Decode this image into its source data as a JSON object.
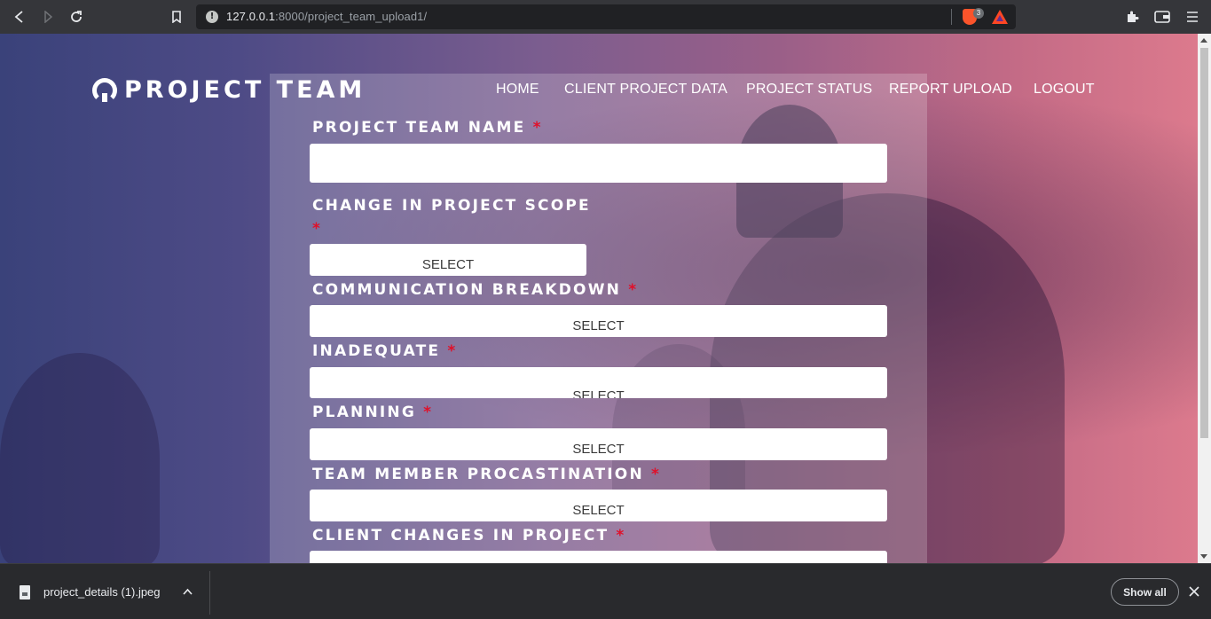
{
  "browser": {
    "url_host": "127.0.0.1",
    "url_rest": ":8000/project_team_upload1/",
    "shield_count": "3",
    "icons": {
      "back": "back-arrow-icon",
      "forward": "forward-arrow-icon",
      "reload": "reload-icon",
      "bookmark": "bookmark-icon",
      "info": "site-info-icon",
      "brave_shield": "brave-shield-icon",
      "rewards": "brave-rewards-icon",
      "extensions": "puzzle-icon",
      "wallet": "wallet-icon",
      "menu": "hamburger-menu-icon"
    }
  },
  "site": {
    "logo_text": "PROJECT TEAM",
    "nav": [
      "HOME",
      "CLIENT PROJECT DATA",
      "PROJECT STATUS",
      "REPORT UPLOAD",
      "LOGOUT"
    ]
  },
  "form": {
    "required_mark": "*",
    "fields": [
      {
        "label": "PROJECT TEAM NAME",
        "type": "text",
        "value": ""
      },
      {
        "label": "CHANGE IN PROJECT SCOPE",
        "type": "select",
        "value": "SELECT"
      },
      {
        "label": "COMMUNICATION BREAKDOWN",
        "type": "select",
        "value": "SELECT"
      },
      {
        "label": "INADEQUATE",
        "type": "select",
        "value": "SELECT"
      },
      {
        "label": "PLANNING",
        "type": "select",
        "value": "SELECT"
      },
      {
        "label": "TEAM MEMBER PROCASTINATION",
        "type": "select",
        "value": "SELECT"
      },
      {
        "label": "CLIENT CHANGES IN PROJECT",
        "type": "select",
        "value": ""
      }
    ]
  },
  "downloads": {
    "file_name": "project_details (1).jpeg",
    "show_all": "Show all"
  },
  "colors": {
    "accent_required": "#e0102a",
    "toolbar_bg": "#35363a",
    "downloads_bg": "#292a2d"
  }
}
